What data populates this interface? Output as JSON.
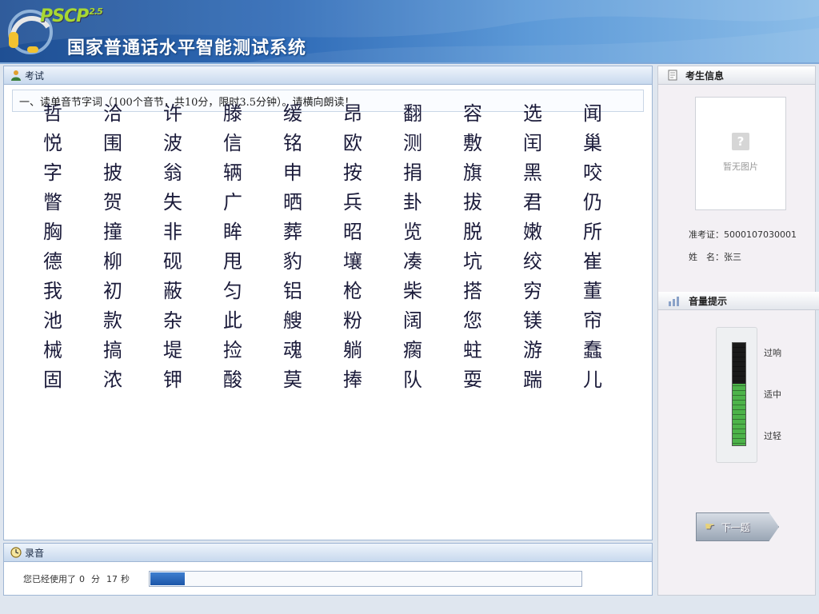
{
  "header": {
    "brand": "PSCP",
    "version": "2.5",
    "title": "国家普通话水平智能测试系统"
  },
  "exam": {
    "panel_title": "考试",
    "instruction": "一、读单音节字词（100个音节，共10分，限时3.5分钟）。请横向朗读！",
    "characters": [
      "哲",
      "洽",
      "许",
      "滕",
      "缓",
      "昂",
      "翻",
      "容",
      "选",
      "闻",
      "悦",
      "围",
      "波",
      "信",
      "铭",
      "欧",
      "测",
      "敷",
      "闰",
      "巢",
      "字",
      "披",
      "翁",
      "辆",
      "申",
      "按",
      "捐",
      "旗",
      "黑",
      "咬",
      "瞥",
      "贺",
      "失",
      "广",
      "晒",
      "兵",
      "卦",
      "拔",
      "君",
      "仍",
      "胸",
      "撞",
      "非",
      "眸",
      "葬",
      "昭",
      "览",
      "脱",
      "嫩",
      "所",
      "德",
      "柳",
      "砚",
      "甩",
      "豹",
      "壤",
      "凑",
      "坑",
      "绞",
      "崔",
      "我",
      "初",
      "蔽",
      "匀",
      "铝",
      "枪",
      "柴",
      "搭",
      "穷",
      "董",
      "池",
      "款",
      "杂",
      "此",
      "艘",
      "粉",
      "阔",
      "您",
      "镁",
      "帘",
      "械",
      "搞",
      "堤",
      "捡",
      "魂",
      "躺",
      "瘸",
      "蛀",
      "游",
      "蠢",
      "固",
      "浓",
      "钾",
      "酸",
      "莫",
      "捧",
      "队",
      "耍",
      "踹",
      "儿"
    ]
  },
  "recording": {
    "panel_title": "录音",
    "used_prefix": "您已经使用了",
    "minutes": "0",
    "minute_unit": "分",
    "seconds": "17",
    "second_unit": "秒",
    "progress_fraction": 0.08
  },
  "candidate": {
    "panel_title": "考生信息",
    "photo_placeholder": "暂无图片",
    "ticket_label": "准考证：",
    "ticket_number": "5000107030001",
    "name_label": "姓　名：",
    "name": "张三"
  },
  "volume": {
    "panel_title": "音量提示",
    "labels": {
      "loud": "过响",
      "moderate": "适中",
      "quiet": "过轻"
    },
    "level_fraction": 0.6
  },
  "next_button": {
    "label": "下一题"
  },
  "colors": {
    "header_dark": "#1f4f93",
    "brand_green": "#a8d832",
    "progress_blue": "#1d56a8",
    "meter_green": "#4db34a"
  }
}
